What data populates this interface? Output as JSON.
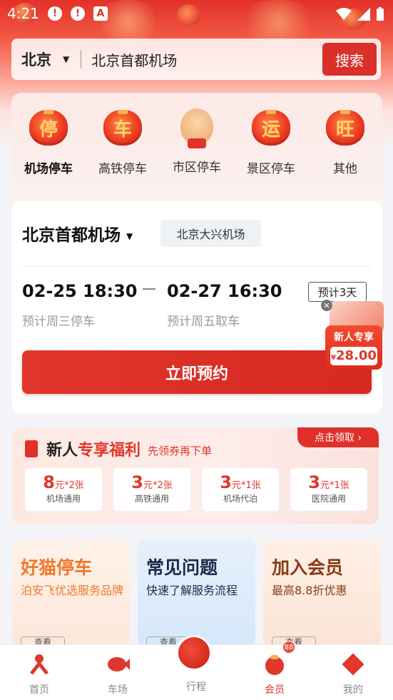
{
  "status_bar": {
    "time": "4:21"
  },
  "search": {
    "city": "北京",
    "query": "北京首都机场",
    "button": "搜索"
  },
  "categories": [
    {
      "label": "机场停车",
      "glyph": "停",
      "icon": "lantern-icon",
      "active": true
    },
    {
      "label": "高铁停车",
      "glyph": "车",
      "icon": "lantern-icon"
    },
    {
      "label": "市区停车",
      "glyph": "",
      "icon": "horse-mascot-icon"
    },
    {
      "label": "景区停车",
      "glyph": "运",
      "icon": "lantern-icon"
    },
    {
      "label": "其他",
      "glyph": "旺",
      "icon": "lantern-icon"
    }
  ],
  "booking": {
    "airport_selected": "北京首都机场",
    "airport_alt": "北京大兴机场",
    "start_time": "02-25 18:30",
    "end_time": "02-27 16:30",
    "start_sub": "预计周三停车",
    "end_sub": "预计周五取车",
    "duration": "预计3天",
    "book_button": "立即预约"
  },
  "floater": {
    "title": "新人专享",
    "currency": "¥",
    "price": "28.00"
  },
  "promo": {
    "title_a": "新人",
    "title_b": "专享福利",
    "subtitle": "先领券再下单",
    "claim": "点击领取 ›",
    "coupons": [
      {
        "amount": "8",
        "unit": "元*2张",
        "desc": "机场通用"
      },
      {
        "amount": "3",
        "unit": "元*2张",
        "desc": "高铁通用"
      },
      {
        "amount": "3",
        "unit": "元*1张",
        "desc": "机场代泊"
      },
      {
        "amount": "3",
        "unit": "元*1张",
        "desc": "医院通用"
      }
    ]
  },
  "tiles": [
    {
      "title": "好猫停车",
      "desc": "泊安飞优选服务品牌",
      "more": "查看",
      "color": "#f0782c"
    },
    {
      "title": "常见问题",
      "desc": "快速了解服务流程",
      "more": "查看",
      "color": "#1d2b4a"
    },
    {
      "title": "加入会员",
      "desc": "最高8.8折优惠",
      "more": "查看",
      "color": "#8a3b18"
    }
  ],
  "tabbar": {
    "tabs": [
      {
        "label": "首页"
      },
      {
        "label": "车场"
      },
      {
        "label": "行程"
      },
      {
        "label": "会员",
        "active": true,
        "badge": "88"
      },
      {
        "label": "我的"
      }
    ]
  },
  "colors": {
    "brand_red": "#e0362b",
    "accent_orange": "#f0782c"
  }
}
